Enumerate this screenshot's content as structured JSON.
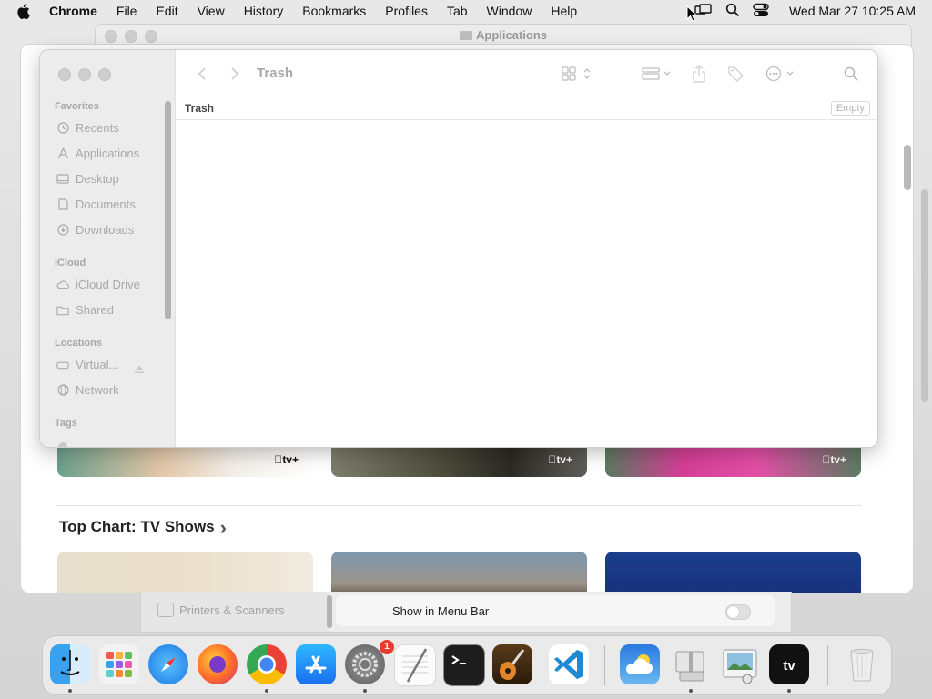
{
  "menubar": {
    "app_name": "Chrome",
    "items": [
      "File",
      "Edit",
      "View",
      "History",
      "Bookmarks",
      "Profiles",
      "Tab",
      "Window",
      "Help"
    ],
    "clock": "Wed Mar 27  10:25 AM"
  },
  "background_window": {
    "title": "Applications"
  },
  "tv_app": {
    "badge": "tv+",
    "section_title": "Top Chart: TV Shows",
    "section_chevron": "›"
  },
  "settings": {
    "sidebar_item": "Printers & Scanners",
    "row_label": "Show in Menu Bar"
  },
  "finder": {
    "title": "Trash",
    "path_label": "Trash",
    "empty_button": "Empty",
    "sidebar": {
      "sections": [
        {
          "label": "Favorites",
          "items": [
            "Recents",
            "Applications",
            "Desktop",
            "Documents",
            "Downloads"
          ]
        },
        {
          "label": "iCloud",
          "items": [
            "iCloud Drive",
            "Shared"
          ]
        },
        {
          "label": "Locations",
          "items": [
            "Virtual...",
            "Network"
          ]
        },
        {
          "label": "Tags",
          "items": []
        }
      ]
    }
  },
  "dock": {
    "apps": [
      "Finder",
      "Launchpad",
      "Safari",
      "Firefox",
      "Google Chrome",
      "App Store",
      "System Settings",
      "TextEdit",
      "Terminal",
      "GarageBand",
      "Visual Studio Code",
      "Weather",
      "Archive Utility",
      "Preview",
      "TV",
      "Trash"
    ],
    "system_settings_badge": "1"
  }
}
